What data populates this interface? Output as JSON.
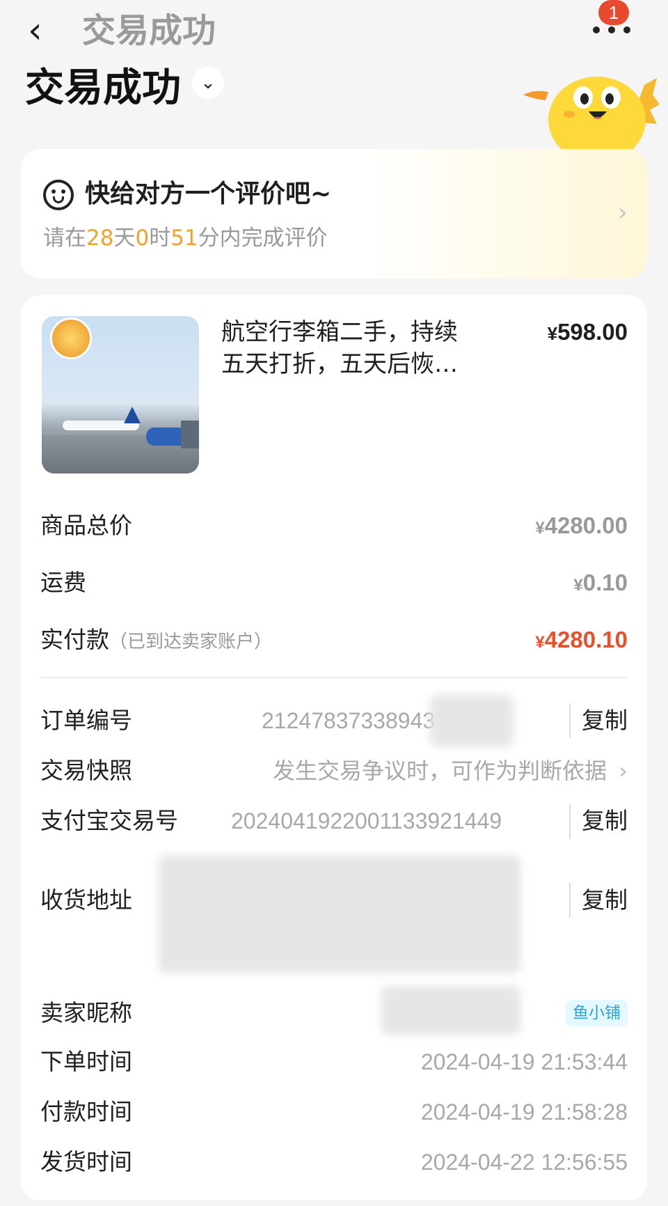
{
  "nav": {
    "title": "交易成功",
    "back_icon": "chevron-left-icon",
    "more_icon": "more-dots-icon",
    "badge_count": "1"
  },
  "status": {
    "title": "交易成功",
    "toggle_icon": "chevron-down-icon",
    "mascot_icon": "yellow-fish-mascot-icon"
  },
  "review": {
    "icon": "face-icon",
    "title": "快给对方一个评价吧~",
    "prefix": "请在",
    "days": "28",
    "days_unit": "天",
    "hours": "0",
    "hours_unit": "时",
    "minutes": "51",
    "minutes_suffix": "分内完成评价",
    "accent_color": "#f2a12a"
  },
  "item": {
    "title": "航空行李箱二手，持续五天打折，五天后恢复原…",
    "currency": "¥",
    "price": "598.00"
  },
  "summary": {
    "total_label": "商品总价",
    "total_currency": "¥",
    "total_value": "4280.00",
    "shipping_label": "运费",
    "shipping_currency": "¥",
    "shipping_value": "0.10",
    "paid_label": "实付款",
    "paid_note": "（已到达卖家账户）",
    "paid_currency": "¥",
    "paid_value": "4280.10",
    "paid_color": "#e8502c"
  },
  "info": {
    "order_no_label": "订单编号",
    "order_no_value": "21247837338943",
    "copy_label": "复制",
    "snapshot_label": "交易快照",
    "snapshot_value": "发生交易争议时，可作为判断依据",
    "alipay_label": "支付宝交易号",
    "alipay_value": "20240419220011339214​49",
    "address_label": "收货地址",
    "seller_label": "卖家昵称",
    "seller_tag": "鱼小铺",
    "order_time_label": "下单时间",
    "order_time_value": "2024-04-19 21:53:44",
    "pay_time_label": "付款时间",
    "pay_time_value": "2024-04-19 21:58:28",
    "ship_time_label": "发货时间",
    "ship_time_value": "2024-04-22 12:56:55"
  }
}
